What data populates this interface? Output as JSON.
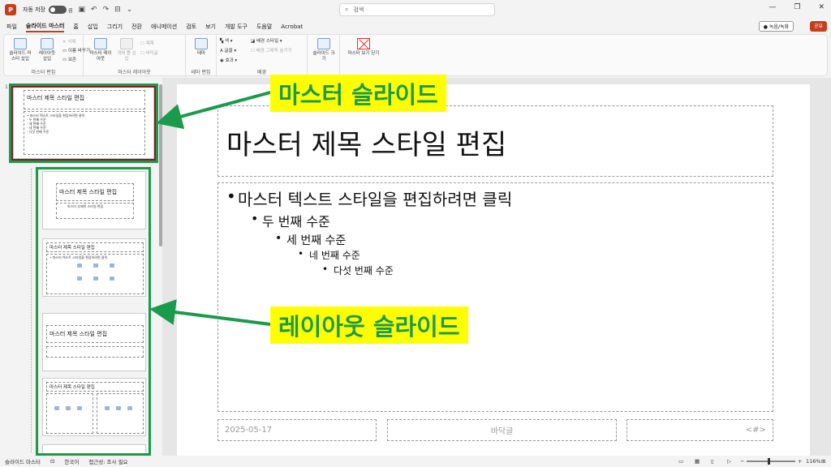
{
  "titlebar": {
    "autosave_label": "자동 저장",
    "autosave_state": "끔",
    "search_placeholder": "검색"
  },
  "menu": {
    "items": [
      "파일",
      "슬라이드 마스터",
      "홈",
      "삽입",
      "그리기",
      "전환",
      "애니메이션",
      "검토",
      "보기",
      "개발 도구",
      "도움말",
      "Acrobat"
    ],
    "active_index": 1,
    "record_label": "● 녹음/녹화",
    "share_label": "공유"
  },
  "ribbon": {
    "master_edit": {
      "group_label": "마스터 편집",
      "insert_master": "슬라이드 마스터 삽입",
      "insert_layout": "레이아웃 삽입",
      "delete": "삭제",
      "rename": "이름 바꾸기",
      "preserve": "보존"
    },
    "master_layout": {
      "group_label": "마스터 레이아웃",
      "master_layout_btn": "마스터 레이아웃",
      "insert_placeholder": "개체 틀 삽입",
      "title_check": "제목",
      "footer_check": "바닥글"
    },
    "theme_edit": {
      "group_label": "테마 편집",
      "theme_btn": "테마"
    },
    "background": {
      "group_label": "배경",
      "colors": "색",
      "fonts": "글꼴",
      "effects": "효과",
      "bg_styles": "배경 스타일",
      "hide_bg": "배경 그래픽 숨기기"
    },
    "size": {
      "slide_size": "슬라이드 크기"
    },
    "close": {
      "close_master": "마스터 보기 닫기"
    }
  },
  "thumbnails": {
    "master_number": "1",
    "master_title": "마스터 제목 스타일 편집",
    "master_body": [
      "• 마스터 텍스트 스타일을 편집하려면 클릭",
      "  - 두 번째 수준",
      "    - 세 번째 수준",
      "      - 네 번째 수준",
      "        - 다섯 번째 수준"
    ],
    "layout_titles": [
      "마스터 제목 스타일 편집",
      "마스터 제목 스타일 편집",
      "마스터 제목 스타일 편집",
      "마스터 제목 스타일 편집"
    ],
    "layout1_subtitle": "마스터 부제목 스타일 편집",
    "layout2_body": "• 마스터 텍스트 스타일을 편집하려면 클릭"
  },
  "callouts": {
    "master": "마스터 슬라이드",
    "layout": "레이아웃 슬라이드"
  },
  "slide": {
    "title": "마스터 제목 스타일 편집",
    "levels": [
      "마스터 텍스트 스타일을 편집하려면 클릭",
      "두 번째 수준",
      "세 번째 수준",
      "네 번째 수준",
      "다섯 번째 수준"
    ],
    "footer_date": "2025-05-17",
    "footer_text": "바닥글",
    "footer_num": "<#>"
  },
  "status": {
    "view": "슬라이드 마스터",
    "language": "한국어",
    "accessibility": "접근성: 조사 필요",
    "zoom": "116%"
  },
  "colors": {
    "accent": "#c43e1c",
    "highlight_green": "#1a9b4b",
    "callout_bg": "#ffff00"
  }
}
